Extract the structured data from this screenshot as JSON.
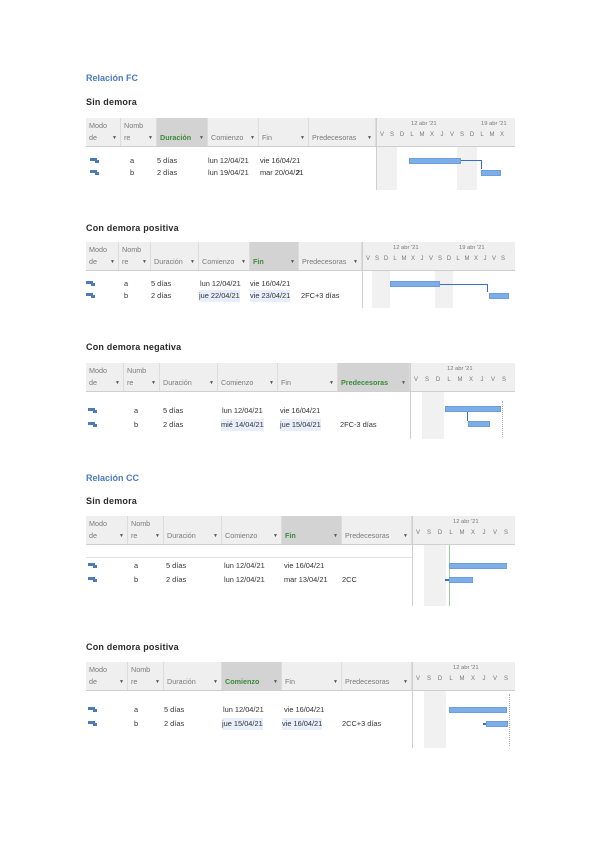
{
  "sections": [
    {
      "title": "Relación FC",
      "subsections": [
        {
          "subtitle": "Sin demora",
          "headers": {
            "mode": [
              "Modo",
              "de"
            ],
            "name": [
              "Nomb",
              "re"
            ],
            "duration": "Duración",
            "start": "Comienzo",
            "end": "Fin",
            "pred": "Predecesoras"
          },
          "gantt_dates": [
            "12 abr '21",
            "19 abr '21"
          ],
          "gantt_days": [
            "V",
            "S",
            "D",
            "L",
            "M",
            "X",
            "J",
            "V",
            "S",
            "D",
            "L",
            "M",
            "X"
          ],
          "rows": [
            {
              "name": "a",
              "duration": "5 días",
              "start": "lun 12/04/21",
              "end": "vie 16/04/21",
              "pred": ""
            },
            {
              "name": "b",
              "duration": "2 días",
              "start": "lun 19/04/21",
              "end": "mar 20/04/21",
              "pred": "2"
            }
          ]
        },
        {
          "subtitle": "Con demora positiva",
          "headers": {
            "mode": [
              "Modo",
              "de"
            ],
            "name": [
              "Nomb",
              "re"
            ],
            "duration": "Duración",
            "start": "Comienzo",
            "end": "Fin",
            "pred": "Predecesoras"
          },
          "gantt_dates": [
            "12 abr '21",
            "19 abr '21"
          ],
          "gantt_days": [
            "V",
            "S",
            "D",
            "L",
            "M",
            "X",
            "J",
            "V",
            "S",
            "D",
            "L",
            "M",
            "X",
            "J",
            "V",
            "S"
          ],
          "rows": [
            {
              "name": "a",
              "duration": "5 días",
              "start": "lun 12/04/21",
              "end": "vie 16/04/21",
              "pred": ""
            },
            {
              "name": "b",
              "duration": "2 días",
              "start": "jue 22/04/21",
              "end": "vie 23/04/21",
              "pred": "2FC+3 días"
            }
          ]
        },
        {
          "subtitle": "Con demora negativa",
          "headers": {
            "mode": [
              "Modo",
              "de"
            ],
            "name": [
              "Numb",
              "re"
            ],
            "duration": "Duración",
            "start": "Comienzo",
            "end": "Fin",
            "pred": "Predecesoras"
          },
          "gantt_dates": [
            "12 abr '21"
          ],
          "gantt_days": [
            "V",
            "S",
            "D",
            "L",
            "M",
            "X",
            "J",
            "V",
            "S"
          ],
          "rows": [
            {
              "name": "a",
              "duration": "5 días",
              "start": "lun 12/04/21",
              "end": "vie 16/04/21",
              "pred": ""
            },
            {
              "name": "b",
              "duration": "2 días",
              "start": "mié 14/04/21",
              "end": "jue 15/04/21",
              "pred": "2FC-3 días"
            }
          ]
        }
      ]
    },
    {
      "title": "Relación CC",
      "subsections": [
        {
          "subtitle": "Sin demora",
          "headers": {
            "mode": [
              "Modo",
              "de"
            ],
            "name": [
              "Nomb",
              "re"
            ],
            "duration": "Duración",
            "start": "Comienzo",
            "end": "Fin",
            "pred": "Predecesoras"
          },
          "gantt_dates": [
            "12 abr '21"
          ],
          "gantt_days": [
            "V",
            "S",
            "D",
            "L",
            "M",
            "X",
            "J",
            "V",
            "S"
          ],
          "rows": [
            {
              "name": "a",
              "duration": "5 días",
              "start": "lun 12/04/21",
              "end": "vie 16/04/21",
              "pred": ""
            },
            {
              "name": "b",
              "duration": "2 días",
              "start": "lun 12/04/21",
              "end": "mar 13/04/21",
              "pred": "2CC"
            }
          ]
        },
        {
          "subtitle": "Con demora positiva",
          "headers": {
            "mode": [
              "Modo",
              "de"
            ],
            "name": [
              "Nomb",
              "re"
            ],
            "duration": "Duración",
            "start": "Comienzo",
            "end": "Fin",
            "pred": "Predecesoras"
          },
          "gantt_dates": [
            "12 abr '21"
          ],
          "gantt_days": [
            "V",
            "S",
            "D",
            "L",
            "M",
            "X",
            "J",
            "V",
            "S"
          ],
          "rows": [
            {
              "name": "a",
              "duration": "5 días",
              "start": "lun 12/04/21",
              "end": "vie 16/04/21",
              "pred": ""
            },
            {
              "name": "b",
              "duration": "2 días",
              "start": "jue 15/04/21",
              "end": "vie 16/04/21",
              "pred": "2CC+3 días"
            }
          ]
        }
      ]
    }
  ]
}
